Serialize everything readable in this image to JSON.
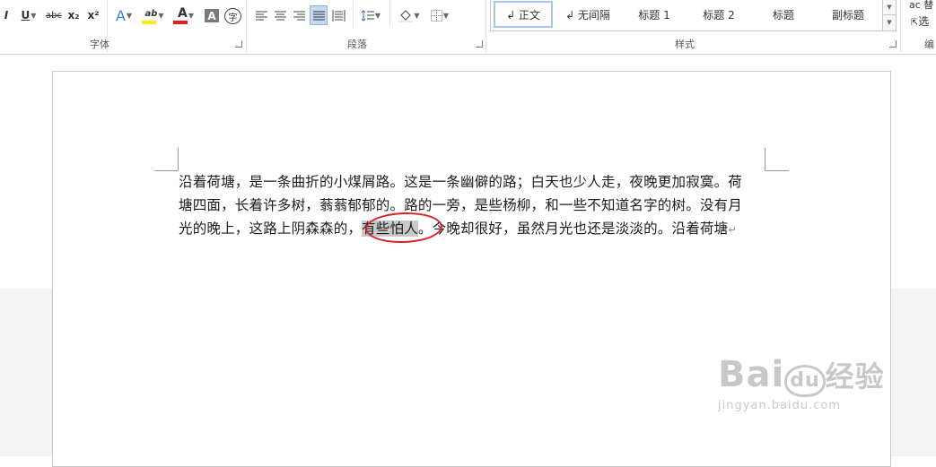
{
  "ribbon": {
    "font_group": {
      "label": "字体",
      "buttons": {
        "italic": "I",
        "underline": "U",
        "strikethrough": "abc",
        "subscript": "x₂",
        "superscript": "x²",
        "text_effects": "A",
        "highlight": "ab",
        "font_color": "A",
        "char_shading": "A",
        "enclose_char": "字"
      },
      "highlight_color": "#ffee00",
      "font_color_bar": "#e02020"
    },
    "paragraph_group": {
      "label": "段落"
    },
    "styles_group": {
      "label": "样式",
      "items": [
        "↲ 正文",
        "↲ 无间隔",
        "标题 1",
        "标题 2",
        "标题",
        "副标题"
      ]
    },
    "edit_group": {
      "label": "编",
      "items": [
        "ac 替",
        "选"
      ]
    }
  },
  "document": {
    "lines": [
      "沿着荷塘，是一条曲折的小煤屑路。这是一条幽僻的路；白天也少人走，夜晚更加寂寞。荷",
      "塘四面，长着许多树，蓊蓊郁郁的。路的一旁，是些杨柳，和一些不知道名字的树。没有月"
    ],
    "line3_before": "光的晚上，这路上阴森森的，",
    "line3_selected": "有些怕人",
    "line3_after": "。今晚却很好，虽然月光也还是淡淡的。沿着荷塘",
    "paragraph_mark": "↵",
    "highlight_color": "#c9c9c9",
    "annotation_color": "#d9232a"
  },
  "watermark": {
    "brand": "Bai",
    "paw": "du",
    "suffix": "经验",
    "url": "jingyan.baidu.com"
  }
}
